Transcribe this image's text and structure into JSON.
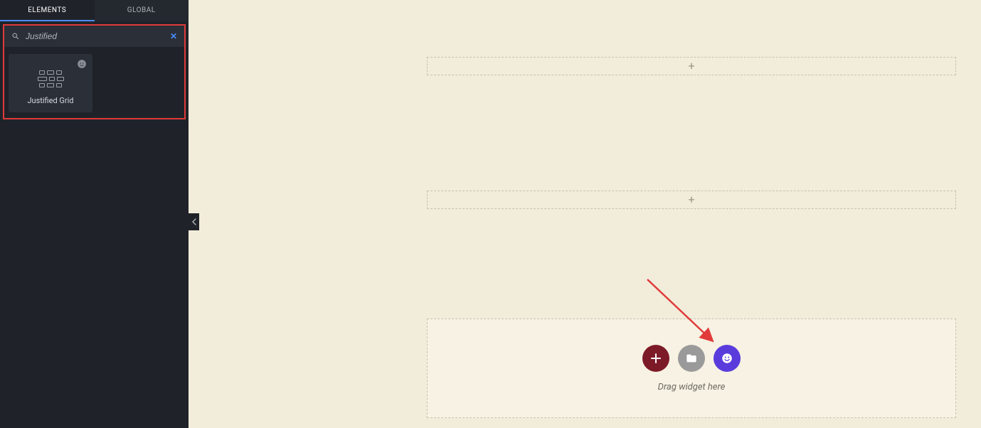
{
  "sidebar": {
    "tabs": {
      "elements": "ELEMENTS",
      "global": "GLOBAL"
    },
    "search": {
      "value": "Justified"
    },
    "widgets": [
      {
        "label": "Justified Grid"
      }
    ]
  },
  "canvas": {
    "drop_hint": "Drag widget here"
  }
}
